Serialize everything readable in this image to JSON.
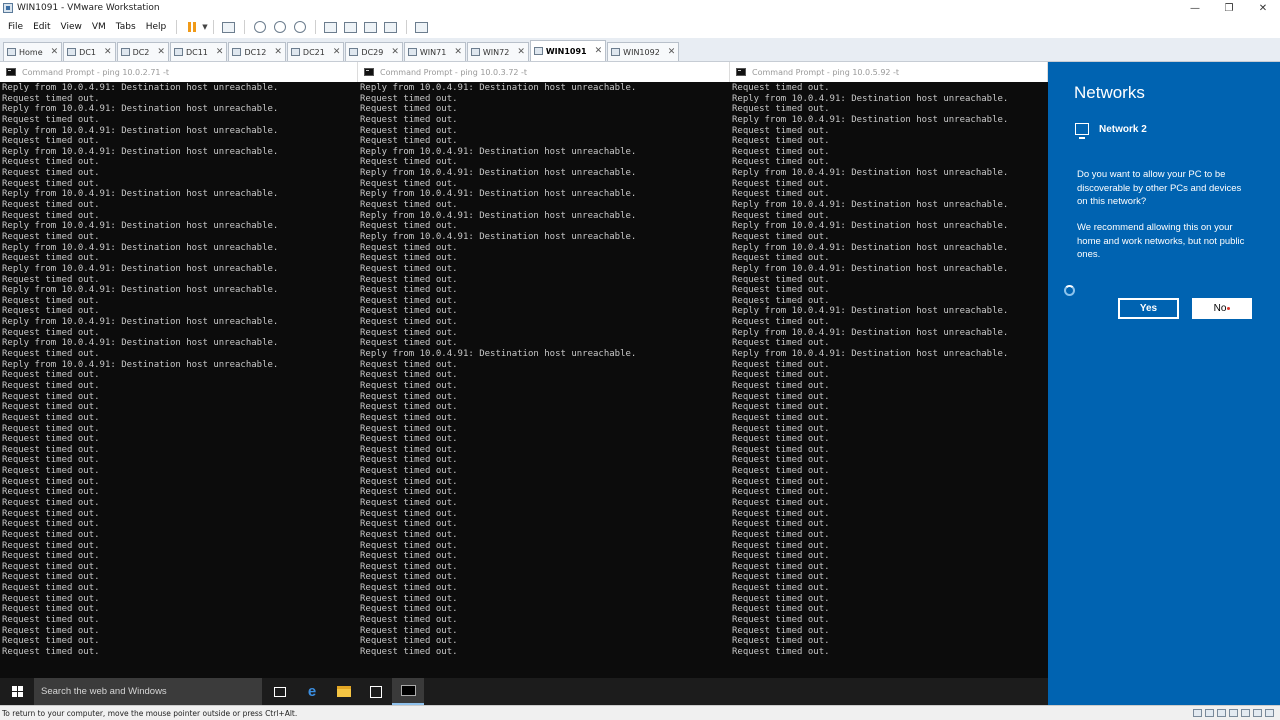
{
  "window": {
    "title": "WIN1091 - VMware Workstation",
    "controls": [
      "—",
      "❐",
      "✕"
    ]
  },
  "menu": [
    "File",
    "Edit",
    "View",
    "VM",
    "Tabs",
    "Help"
  ],
  "tabs": [
    {
      "label": "Home",
      "active": false
    },
    {
      "label": "DC1",
      "active": false
    },
    {
      "label": "DC2",
      "active": false
    },
    {
      "label": "DC11",
      "active": false
    },
    {
      "label": "DC12",
      "active": false
    },
    {
      "label": "DC21",
      "active": false
    },
    {
      "label": "DC29",
      "active": false
    },
    {
      "label": "WIN71",
      "active": false
    },
    {
      "label": "WIN72",
      "active": false
    },
    {
      "label": "WIN1091",
      "active": true
    },
    {
      "label": "WIN1092",
      "active": false
    }
  ],
  "consoles": [
    {
      "title": "Command Prompt - ping  10.0.2.71 -t",
      "lines": [
        "Reply from 10.0.4.91: Destination host unreachable.",
        "Request timed out.",
        "Reply from 10.0.4.91: Destination host unreachable.",
        "Request timed out.",
        "Reply from 10.0.4.91: Destination host unreachable.",
        "Request timed out.",
        "Reply from 10.0.4.91: Destination host unreachable.",
        "Request timed out.",
        "Request timed out.",
        "Request timed out.",
        "Reply from 10.0.4.91: Destination host unreachable.",
        "Request timed out.",
        "Request timed out.",
        "Reply from 10.0.4.91: Destination host unreachable.",
        "Request timed out.",
        "Reply from 10.0.4.91: Destination host unreachable.",
        "Request timed out.",
        "Reply from 10.0.4.91: Destination host unreachable.",
        "Request timed out.",
        "Reply from 10.0.4.91: Destination host unreachable.",
        "Request timed out.",
        "Request timed out.",
        "Reply from 10.0.4.91: Destination host unreachable.",
        "Request timed out.",
        "Reply from 10.0.4.91: Destination host unreachable.",
        "Request timed out.",
        "Reply from 10.0.4.91: Destination host unreachable.",
        "Request timed out.",
        "Request timed out.",
        "Request timed out.",
        "Request timed out.",
        "Request timed out.",
        "Request timed out.",
        "Request timed out.",
        "Request timed out.",
        "Request timed out.",
        "Request timed out.",
        "Request timed out.",
        "Request timed out.",
        "Request timed out.",
        "Request timed out.",
        "Request timed out.",
        "Request timed out.",
        "Request timed out.",
        "Request timed out.",
        "Request timed out.",
        "Request timed out.",
        "Request timed out.",
        "Request timed out.",
        "Request timed out.",
        "Request timed out.",
        "Request timed out.",
        "Request timed out.",
        "Request timed out."
      ]
    },
    {
      "title": "Command Prompt - ping  10.0.3.72 -t",
      "lines": [
        "Reply from 10.0.4.91: Destination host unreachable.",
        "Request timed out.",
        "Request timed out.",
        "Request timed out.",
        "Request timed out.",
        "Request timed out.",
        "Reply from 10.0.4.91: Destination host unreachable.",
        "Request timed out.",
        "Reply from 10.0.4.91: Destination host unreachable.",
        "Request timed out.",
        "Reply from 10.0.4.91: Destination host unreachable.",
        "Request timed out.",
        "Reply from 10.0.4.91: Destination host unreachable.",
        "Request timed out.",
        "Reply from 10.0.4.91: Destination host unreachable.",
        "Request timed out.",
        "Request timed out.",
        "Request timed out.",
        "Request timed out.",
        "Request timed out.",
        "Request timed out.",
        "Request timed out.",
        "Request timed out.",
        "Request timed out.",
        "Request timed out.",
        "Reply from 10.0.4.91: Destination host unreachable.",
        "Request timed out.",
        "Request timed out.",
        "Request timed out.",
        "Request timed out.",
        "Request timed out.",
        "Request timed out.",
        "Request timed out.",
        "Request timed out.",
        "Request timed out.",
        "Request timed out.",
        "Request timed out.",
        "Request timed out.",
        "Request timed out.",
        "Request timed out.",
        "Request timed out.",
        "Request timed out.",
        "Request timed out.",
        "Request timed out.",
        "Request timed out.",
        "Request timed out.",
        "Request timed out.",
        "Request timed out.",
        "Request timed out.",
        "Request timed out.",
        "Request timed out.",
        "Request timed out.",
        "Request timed out.",
        "Request timed out."
      ]
    },
    {
      "title": "Command Prompt - ping  10.0.5.92 -t",
      "lines": [
        "Request timed out.",
        "Reply from 10.0.4.91: Destination host unreachable.",
        "Request timed out.",
        "Reply from 10.0.4.91: Destination host unreachable.",
        "Request timed out.",
        "Request timed out.",
        "Request timed out.",
        "Request timed out.",
        "Reply from 10.0.4.91: Destination host unreachable.",
        "Request timed out.",
        "Request timed out.",
        "Reply from 10.0.4.91: Destination host unreachable.",
        "Request timed out.",
        "Reply from 10.0.4.91: Destination host unreachable.",
        "Request timed out.",
        "Reply from 10.0.4.91: Destination host unreachable.",
        "Request timed out.",
        "Reply from 10.0.4.91: Destination host unreachable.",
        "Request timed out.",
        "Request timed out.",
        "Request timed out.",
        "Reply from 10.0.4.91: Destination host unreachable.",
        "Request timed out.",
        "Reply from 10.0.4.91: Destination host unreachable.",
        "Request timed out.",
        "Reply from 10.0.4.91: Destination host unreachable.",
        "Request timed out.",
        "Request timed out.",
        "Request timed out.",
        "Request timed out.",
        "Request timed out.",
        "Request timed out.",
        "Request timed out.",
        "Request timed out.",
        "Request timed out.",
        "Request timed out.",
        "Request timed out.",
        "Request timed out.",
        "Request timed out.",
        "Request timed out.",
        "Request timed out.",
        "Request timed out.",
        "Request timed out.",
        "Request timed out.",
        "Request timed out.",
        "Request timed out.",
        "Request timed out.",
        "Request timed out.",
        "Request timed out.",
        "Request timed out.",
        "Request timed out.",
        "Request timed out.",
        "Request timed out.",
        "Request timed out."
      ]
    }
  ],
  "networks": {
    "title": "Networks",
    "network_name": "Network 2",
    "question": "Do you want to allow your PC to be discoverable by other PCs and devices on this network?",
    "recommendation": "We recommend allowing this on your home and work networks, but not public ones.",
    "yes_label": "Yes",
    "no_label": "No"
  },
  "taskbar": {
    "search_placeholder": "Search the web and Windows",
    "edge_glyph": "e"
  },
  "statusbar": {
    "text": "To return to your computer, move the mouse pointer outside or press Ctrl+Alt."
  }
}
